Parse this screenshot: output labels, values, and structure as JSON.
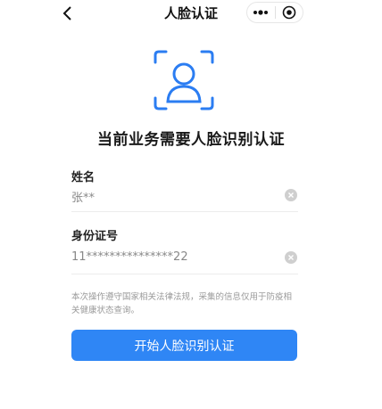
{
  "nav": {
    "title": "人脸认证",
    "back_icon": "chevron-left-icon",
    "menu_icon": "more-dots-icon",
    "close_icon": "target-circle-icon"
  },
  "face_icon": "face-scan-icon",
  "heading": "当前业务需要人脸识别认证",
  "form": {
    "name": {
      "label": "姓名",
      "value": "张**"
    },
    "id": {
      "label": "身份证号",
      "value": "11***************22"
    }
  },
  "notice": "本次操作遵守国家相关法律法规，采集的信息仅用于防疫相关健康状态查询。",
  "start_button": "开始人脸识别认证",
  "colors": {
    "accent": "#2f86f5",
    "icon_blue": "#2b7df2",
    "muted_text": "#9a9a9a"
  }
}
